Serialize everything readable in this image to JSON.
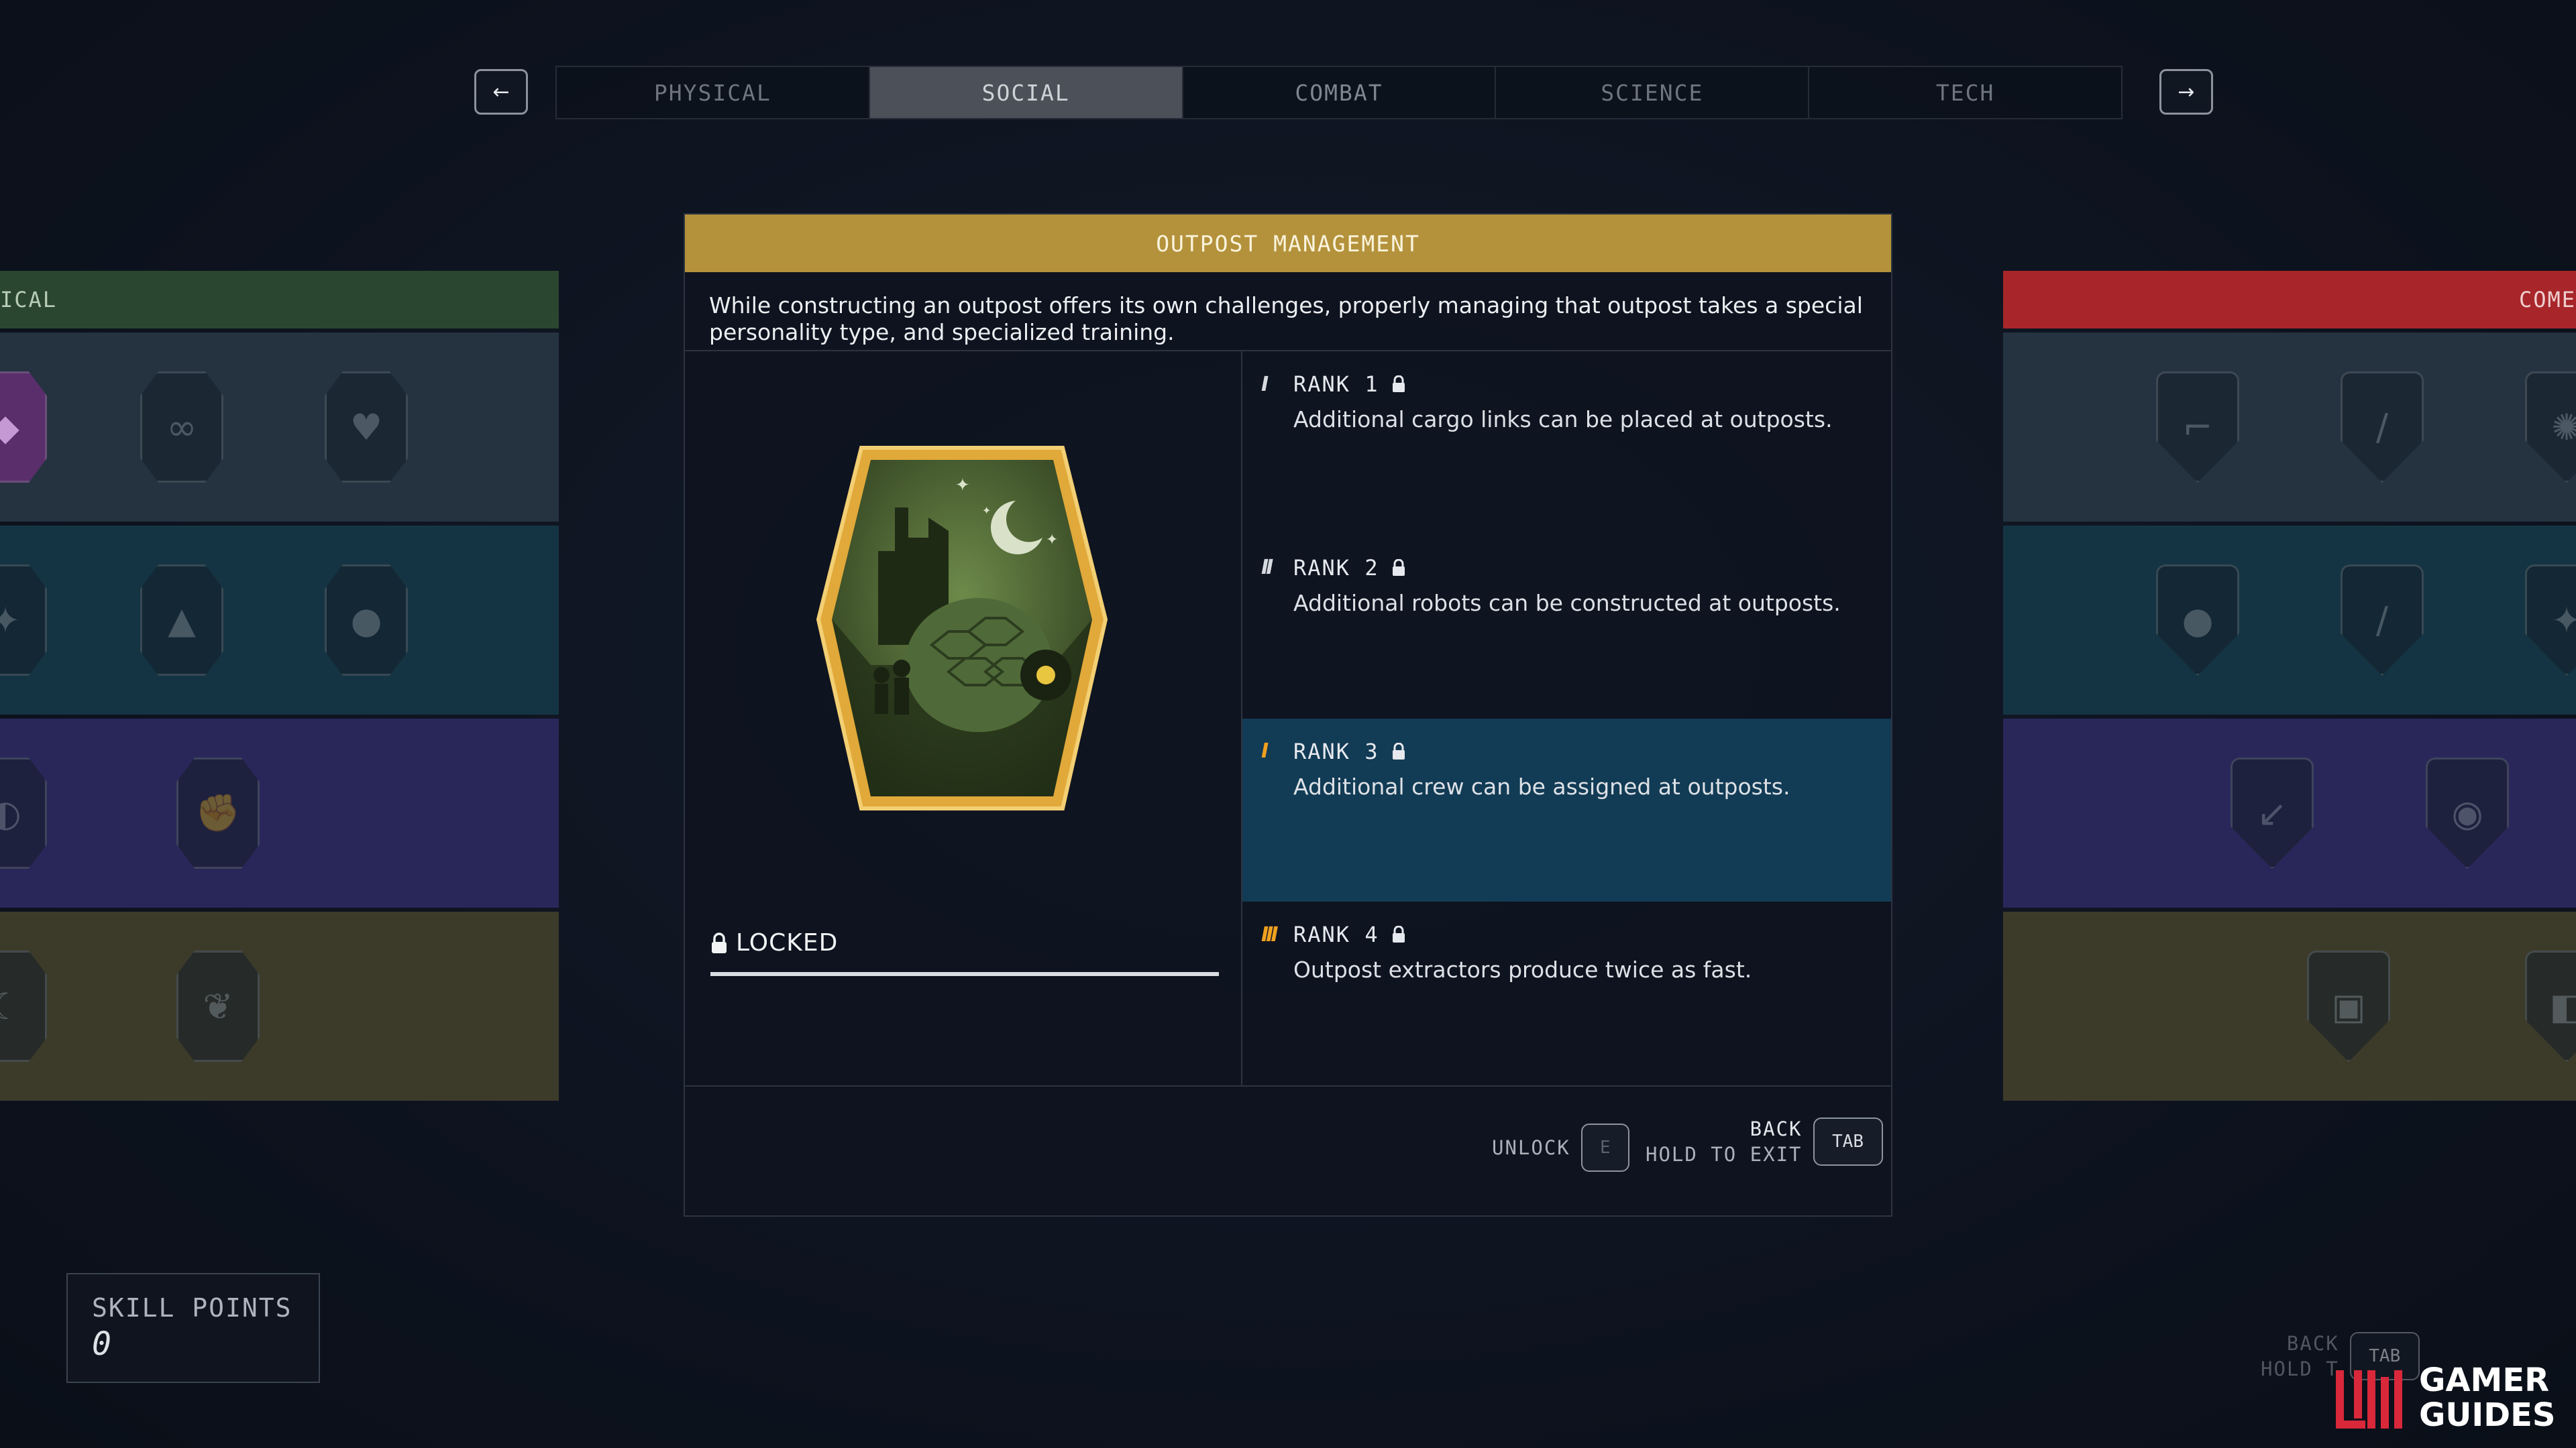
{
  "nav": {
    "left_arrow": "←",
    "right_arrow": "→",
    "tabs": [
      {
        "label": "PHYSICAL"
      },
      {
        "label": "SOCIAL"
      },
      {
        "label": "COMBAT"
      },
      {
        "label": "SCIENCE"
      },
      {
        "label": "TECH"
      }
    ],
    "active_tab": "SOCIAL"
  },
  "left_panel": {
    "header": "ICAL",
    "color": "#2b4630"
  },
  "right_panel": {
    "header": "COME",
    "color": "#a8262a"
  },
  "perk": {
    "title": "OUTPOST MANAGEMENT",
    "description": "While constructing an outpost offers its own challenges, properly managing that outpost takes a special personality type, and specialized training.",
    "status": "LOCKED",
    "ranks": [
      {
        "label": "RANK 1",
        "text": "Additional cargo links can be placed at outposts.",
        "pips": "I",
        "pip_color": "white"
      },
      {
        "label": "RANK 2",
        "text": "Additional robots can be constructed at outposts.",
        "pips": "II",
        "pip_color": "white"
      },
      {
        "label": "RANK 3",
        "text": "Additional crew can be assigned at outposts.",
        "pips": "I",
        "pip_color": "orange",
        "selected": true
      },
      {
        "label": "RANK 4",
        "text": "Outpost extractors produce twice as fast.",
        "pips": "III",
        "pip_color": "orange"
      }
    ]
  },
  "footer": {
    "unlock_label": "UNLOCK",
    "unlock_key": "E",
    "back_label": "BACK",
    "hold_label": "HOLD TO EXIT",
    "back_key": "TAB"
  },
  "skill_points": {
    "label": "SKILL POINTS",
    "value": "0"
  },
  "faded_hint": {
    "back": "BACK",
    "hold": "HOLD T",
    "key": "TAB"
  },
  "watermark": {
    "line1": "GAMER",
    "line2": "GUIDES"
  },
  "colors": {
    "accent_gold": "#b4923c",
    "selected_row": "#123b55",
    "pip_orange": "#f0a020"
  }
}
